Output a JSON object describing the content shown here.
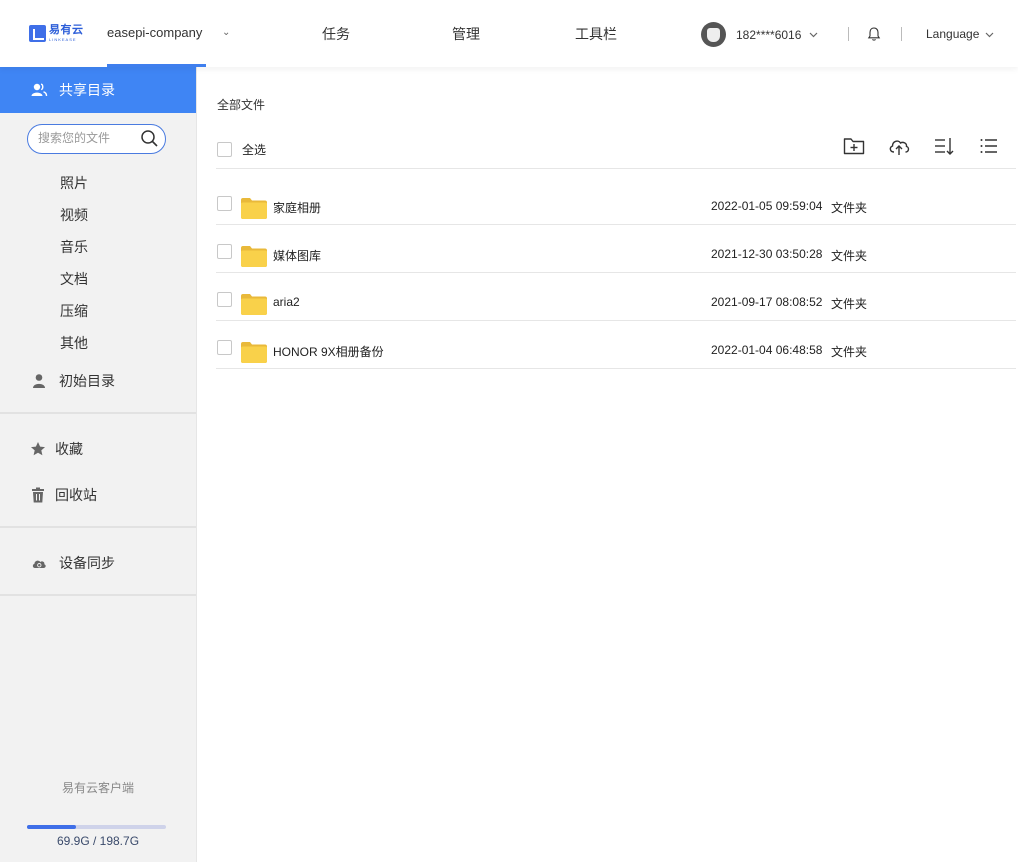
{
  "header": {
    "logo_cn": "易有云",
    "logo_en": "LINKEASE",
    "company": "easepi-company",
    "nav": [
      "任务",
      "管理",
      "工具栏"
    ],
    "user_phone": "182****6016",
    "language": "Language"
  },
  "sidebar": {
    "shared_label": "共享目录",
    "search_placeholder": "搜索您的文件",
    "categories": [
      "照片",
      "视频",
      "音乐",
      "文档",
      "压缩",
      "其他"
    ],
    "initial_label": "初始目录",
    "favorites_label": "收藏",
    "trash_label": "回收站",
    "sync_label": "设备同步",
    "client_label": "易有云客户端",
    "quota_text": "69.9G / 198.7G",
    "quota_used_fraction": 0.352
  },
  "main": {
    "breadcrumb": "全部文件",
    "select_all": "全选",
    "files": [
      {
        "name": "家庭相册",
        "date": "2022-01-05 09:59:04",
        "type": "文件夹"
      },
      {
        "name": "媒体图库",
        "date": "2021-12-30 03:50:28",
        "type": "文件夹"
      },
      {
        "name": "aria2",
        "date": "2021-09-17 08:08:52",
        "type": "文件夹"
      },
      {
        "name": "HONOR 9X相册备份",
        "date": "2022-01-04 06:48:58",
        "type": "文件夹"
      }
    ]
  },
  "colors": {
    "accent": "#3f85f4",
    "folder": "#f9d14a"
  }
}
